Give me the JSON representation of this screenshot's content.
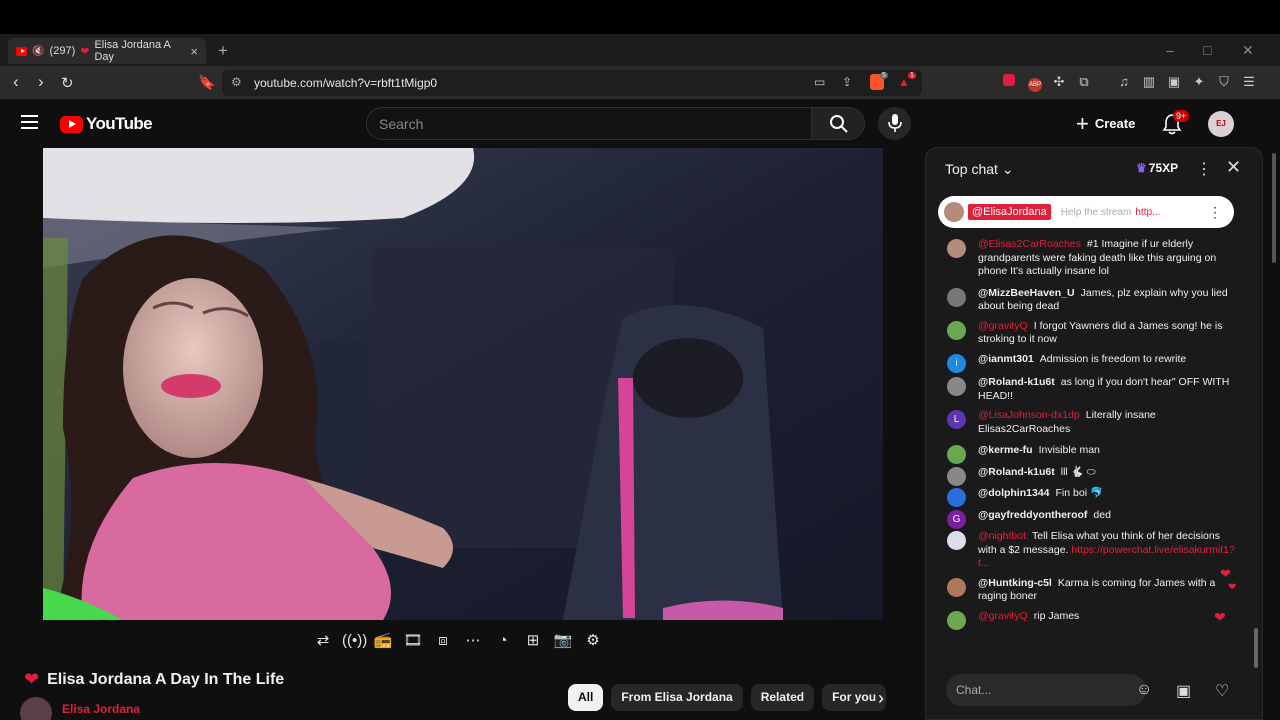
{
  "browser": {
    "tab": {
      "badge": "(297)",
      "title": "Elisa Jordana A Day",
      "close": "×"
    },
    "new_tab": "+",
    "window_controls": [
      "–",
      "□",
      "✕"
    ],
    "url": "youtube.com/watch?v=rbft1tMigp0",
    "extension_badges": {
      "brave_count": "5",
      "alert_count": "1"
    }
  },
  "youtube": {
    "logo_text": "YouTube",
    "search_placeholder": "Search",
    "create_label": "Create",
    "notif_badge": "9+",
    "avatar_text": "EJ"
  },
  "video": {
    "title": "Elisa Jordana A Day In The Life",
    "channel": "Elisa Jordana",
    "controls": [
      "loop-icon",
      "live-icon",
      "radio-icon",
      "clip-icon",
      "screen-icon",
      "captions-icon",
      "speed-icon",
      "plus-icon",
      "camera-icon",
      "settings-icon"
    ]
  },
  "chips": [
    "All",
    "From Elisa Jordana",
    "Related",
    "For you"
  ],
  "chat": {
    "mode": "Top chat",
    "xp": "75XP",
    "pinned": {
      "author": "@ElisaJordana",
      "text": "Help the stream",
      "link": "http..."
    },
    "messages": [
      {
        "author": "@Elisas2CarRoaches",
        "red": true,
        "text": "#1 Imagine if ur elderly grandparents were faking death like this arguing on phone It's actually insane lol",
        "avatar": "#b58c7c",
        "initial": ""
      },
      {
        "author": "@MizzBeeHaven_U",
        "red": false,
        "text": "James, plz explain why you lied about being dead",
        "avatar": "#777",
        "initial": ""
      },
      {
        "author": "@gravityQ",
        "red": true,
        "text": "I forgot Yawners did a James song! he is stroking to it now",
        "avatar": "#6aa84f",
        "initial": ""
      },
      {
        "author": "@ianmt301",
        "red": false,
        "text": "Admission is freedom to rewrite",
        "avatar": "#1e88e5",
        "initial": "i"
      },
      {
        "author": "@Roland-k1u6t",
        "red": false,
        "text": "as long if you don't hear\" OFF WITH HEAD!!",
        "avatar": "#888",
        "initial": ""
      },
      {
        "author": "@LisaJohnson-dx1dp",
        "red": true,
        "text": "Literally insane Elisas2CarRoaches",
        "avatar": "#5e35b1",
        "initial": "L"
      },
      {
        "author": "@kerme-fu",
        "red": false,
        "text": "Invisible man",
        "avatar": "#6aa84f",
        "initial": ""
      },
      {
        "author": "@Roland-k1u6t",
        "red": false,
        "text": "lll 🐇 ⬭",
        "avatar": "#888",
        "initial": ""
      },
      {
        "author": "@dolphin1344",
        "red": false,
        "text": "Fin boi 🐬",
        "avatar": "#2a6fdb",
        "initial": ""
      },
      {
        "author": "@gayfreddyontheroof",
        "red": false,
        "text": "ded",
        "avatar": "#7b1fa2",
        "initial": "G"
      },
      {
        "author": "@nightbot",
        "red": true,
        "text": "Tell Elisa what you think of her decisions with a $2 message.",
        "link": "https://powerchat.live/elisakurmit1?t...",
        "avatar": "#dde",
        "initial": ""
      },
      {
        "author": "@Huntking-c5l",
        "red": false,
        "text": "Karma is coming for James with a raging boner",
        "avatar": "#b0785a",
        "initial": ""
      },
      {
        "author": "@gravityQ",
        "red": true,
        "text": "rip James",
        "avatar": "#6aa84f",
        "initial": ""
      }
    ],
    "input_placeholder": "Chat..."
  }
}
